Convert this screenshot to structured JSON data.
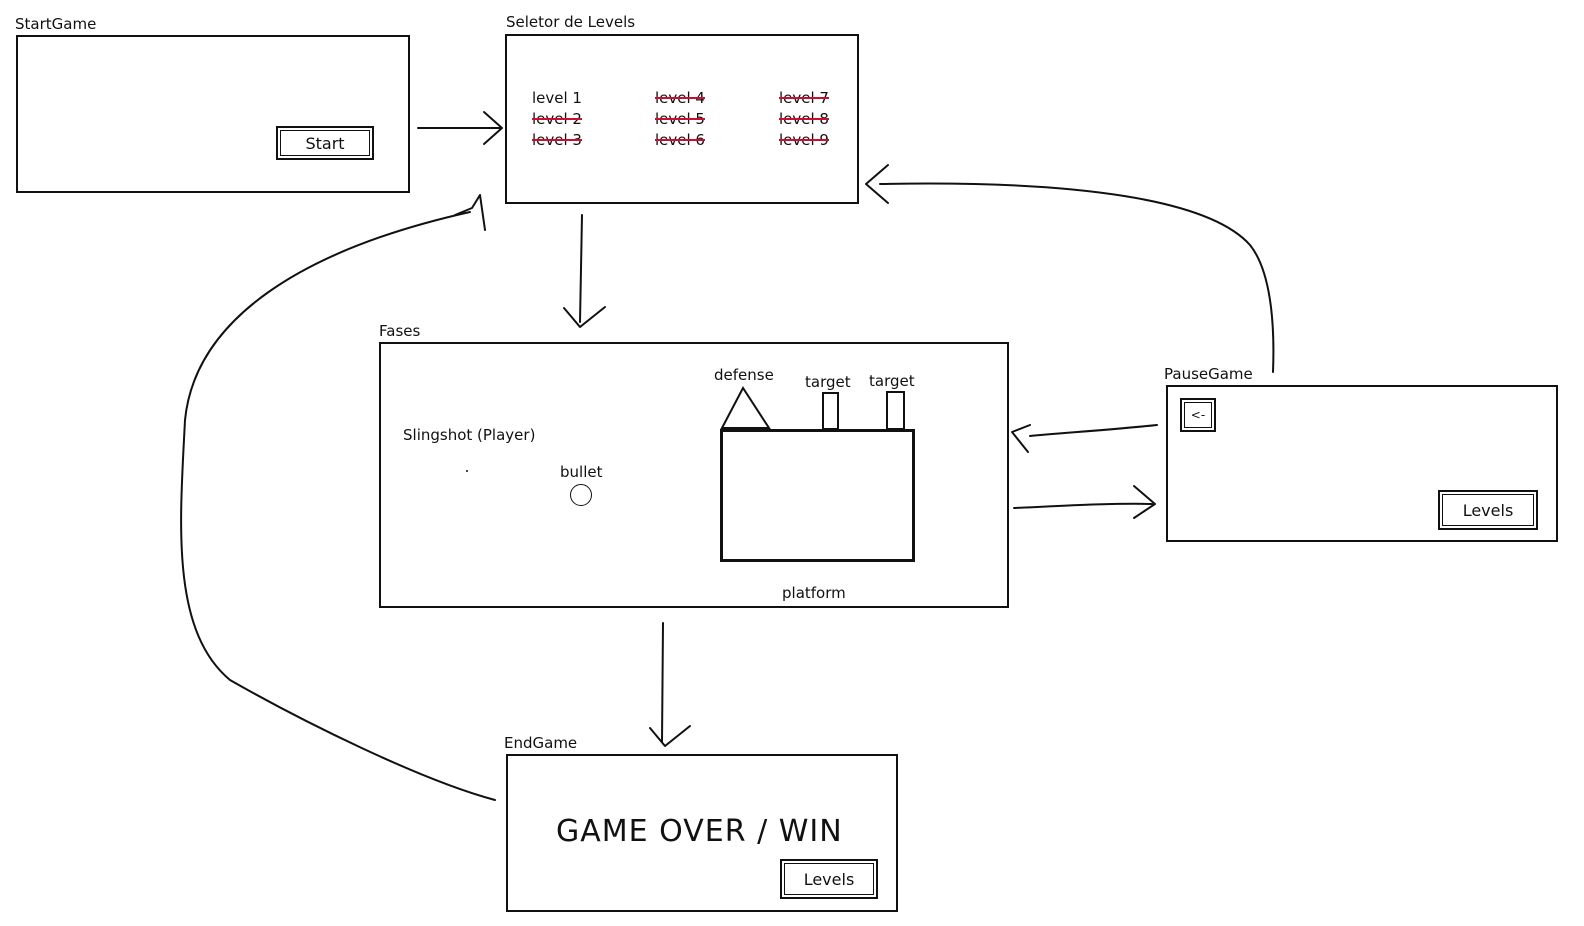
{
  "screens": {
    "start_game": {
      "title": "StartGame",
      "start_button": "Start"
    },
    "level_selector": {
      "title": "Seletor de Levels",
      "levels": [
        {
          "label": "level 1",
          "locked": false
        },
        {
          "label": "level 2",
          "locked": true
        },
        {
          "label": "level 3",
          "locked": true
        },
        {
          "label": "level 4",
          "locked": true
        },
        {
          "label": "level 5",
          "locked": true
        },
        {
          "label": "level 6",
          "locked": true
        },
        {
          "label": "level 7",
          "locked": true
        },
        {
          "label": "level 8",
          "locked": true
        },
        {
          "label": "level 9",
          "locked": true
        }
      ]
    },
    "fases": {
      "title": "Fases",
      "slingshot": "Slingshot (Player)",
      "bullet": "bullet",
      "defense": "defense",
      "target_1": "target",
      "target_2": "target",
      "platform": "platform"
    },
    "pause_game": {
      "title": "PauseGame",
      "back_button": "<-",
      "levels_button": "Levels"
    },
    "end_game": {
      "title": "EndGame",
      "message": "GAME OVER / WIN",
      "levels_button": "Levels"
    }
  },
  "colors": {
    "ink": "#111111",
    "locked_strike": "#c8102e"
  }
}
